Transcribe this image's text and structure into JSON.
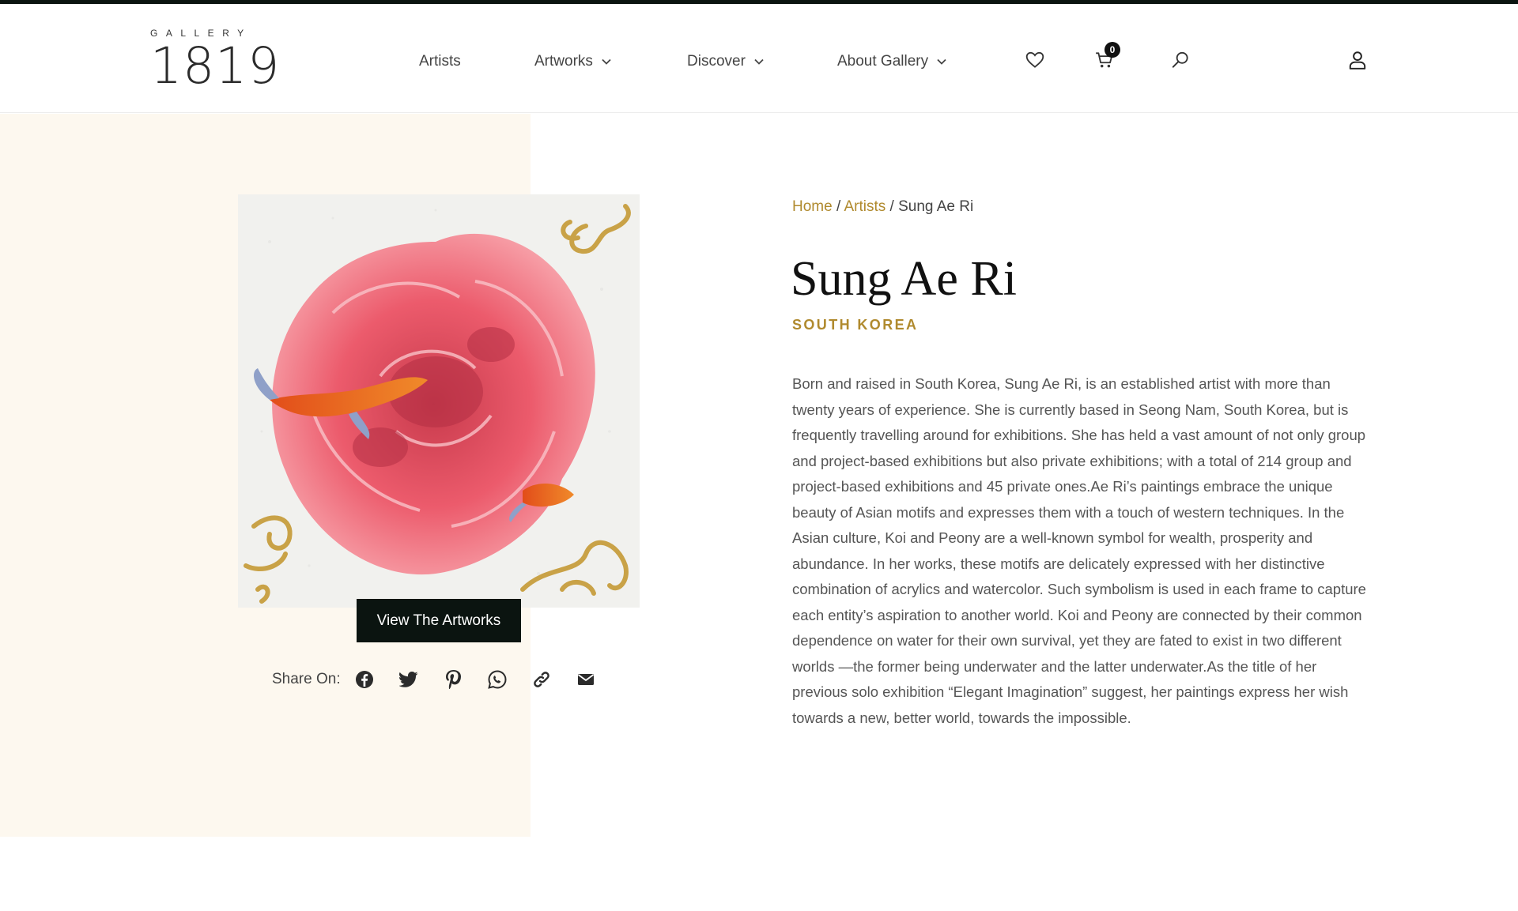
{
  "header": {
    "logo_small": "GALLERY",
    "logo_big": "1819",
    "nav": [
      {
        "label": "Artists",
        "has_dropdown": false
      },
      {
        "label": "Artworks",
        "has_dropdown": true
      },
      {
        "label": "Discover",
        "has_dropdown": true
      },
      {
        "label": "About Gallery",
        "has_dropdown": true
      }
    ],
    "icons": [
      "heart-icon",
      "cart-icon",
      "search-icon",
      "user-icon"
    ],
    "cart_count": "0"
  },
  "artist": {
    "breadcrumb": {
      "home": "Home",
      "artists": "Artists",
      "current": "Sung Ae Ri",
      "separator": "/"
    },
    "name": "Sung Ae Ri",
    "country": "SOUTH KOREA",
    "bio": "Born and raised in South Korea, Sung Ae Ri, is an established artist with more than twenty years of experience. She is currently based in Seong Nam, South Korea, but is frequently travelling around for exhibitions. She has held a vast amount of not only group and project-based exhibitions but also private exhibitions; with a total of 214 group and project-based exhibitions and 45 private ones.Ae Ri’s paintings embrace the unique beauty of Asian motifs and expresses them with a touch of western techniques. In the Asian culture, Koi and Peony are a well-known symbol for wealth, prosperity and abundance. In her works, these motifs are delicately expressed with her distinctive combination of acrylics and watercolor. Such symbolism is used in each frame to capture each entity’s aspiration to another world. Koi and Peony are connected by their common dependence on water for their own survival, yet they are fated to exist in two different worlds —the former being underwater and the latter underwater.As the title of her previous solo exhibition “Elegant Imagination” suggest, her paintings express her wish towards a new, better world, towards the impossible."
  },
  "view_button": "View The Artworks",
  "share": {
    "label": "Share On:",
    "icons": [
      "facebook-icon",
      "twitter-icon",
      "pinterest-icon",
      "whatsapp-icon",
      "link-icon",
      "email-icon"
    ]
  },
  "colors": {
    "accent_gold": "#b08a2e",
    "dark": "#0b1410",
    "cream": "#fdf8ef"
  }
}
